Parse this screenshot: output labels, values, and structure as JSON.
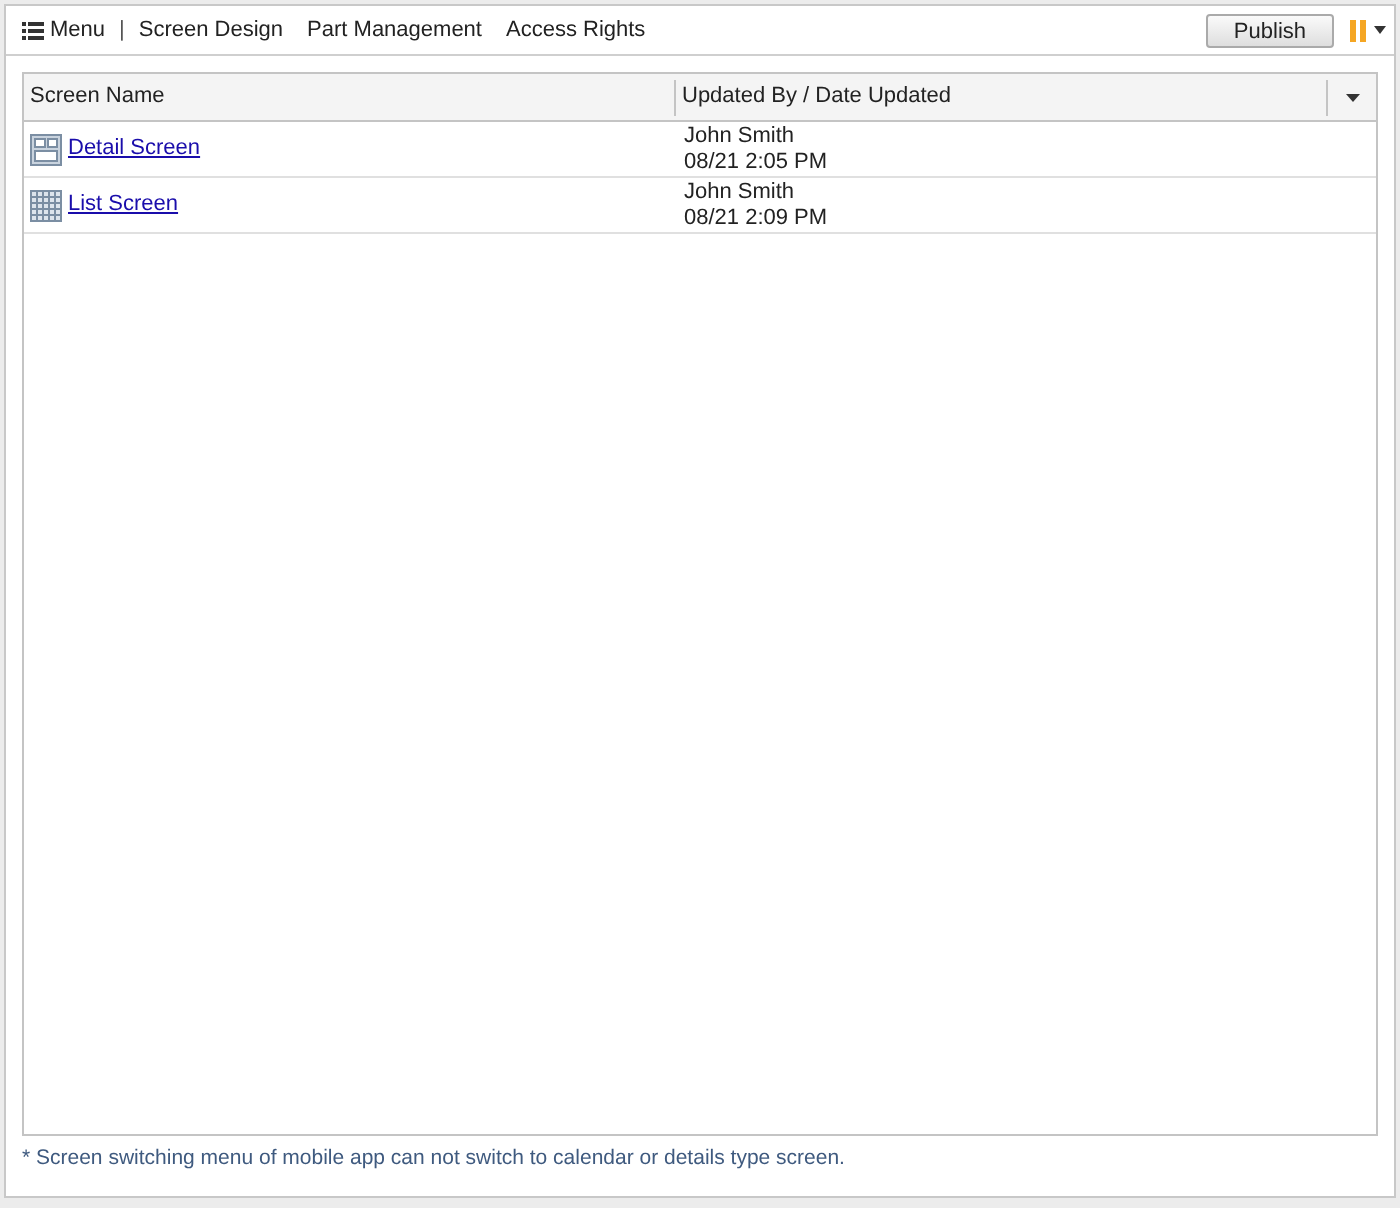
{
  "toolbar": {
    "menu": "Menu",
    "separator": "|",
    "links": [
      "Screen Design",
      "Part Management",
      "Access Rights"
    ],
    "publish": "Publish"
  },
  "table": {
    "columns": [
      "Screen Name",
      "Updated By / Date Updated"
    ],
    "rows": [
      {
        "kind": "detail",
        "name": "Detail Screen",
        "updated_by": "John Smith",
        "updated_at": "08/21 2:05 PM"
      },
      {
        "kind": "list",
        "name": "List Screen",
        "updated_by": "John Smith",
        "updated_at": "08/21 2:09 PM"
      }
    ]
  },
  "note": "* Screen switching menu of mobile app can not switch to calendar or details type screen."
}
